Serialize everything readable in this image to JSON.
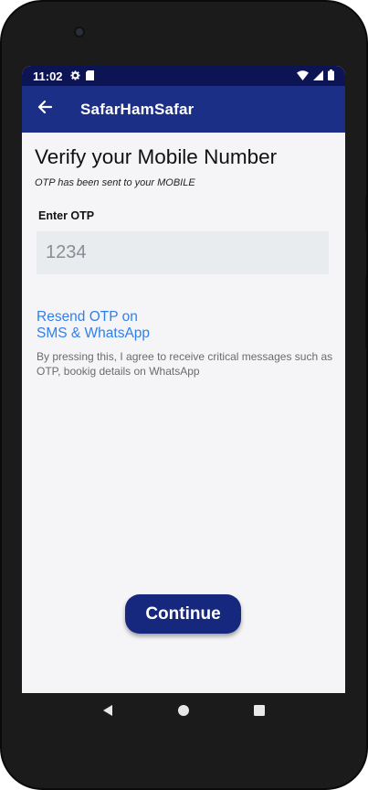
{
  "status_bar": {
    "time": "11:02",
    "icons": [
      "gear-icon",
      "sim-card-icon",
      "wifi-icon",
      "signal-icon",
      "battery-icon"
    ]
  },
  "app_bar": {
    "title": "SafarHamSafar",
    "back_icon": "arrow-left-icon"
  },
  "main": {
    "title": "Verify your Mobile Number",
    "subtitle": "OTP has been sent to your MOBILE",
    "otp_label": "Enter OTP",
    "otp_placeholder": "1234",
    "otp_value": "",
    "resend_line1": "Resend OTP on",
    "resend_line2": "SMS & WhatsApp",
    "consent": "By pressing this, I agree to receive critical messages such as OTP, bookig details on WhatsApp",
    "continue_label": "Continue"
  },
  "nav_bar": {
    "back": "triangle-back-icon",
    "home": "circle-home-icon",
    "recents": "square-recents-icon"
  },
  "colors": {
    "status_bar": "#0d1454",
    "app_bar": "#1b2f86",
    "accent_link": "#2f80ed",
    "primary_button": "#15287e",
    "input_bg": "#e9ecef"
  }
}
